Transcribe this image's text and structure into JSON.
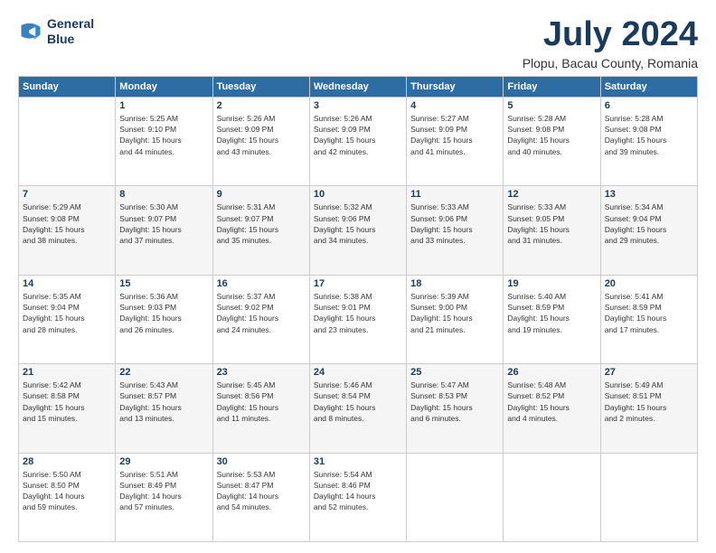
{
  "header": {
    "logo_line1": "General",
    "logo_line2": "Blue",
    "title": "July 2024",
    "subtitle": "Plopu, Bacau County, Romania"
  },
  "weekdays": [
    "Sunday",
    "Monday",
    "Tuesday",
    "Wednesday",
    "Thursday",
    "Friday",
    "Saturday"
  ],
  "weeks": [
    [
      {
        "day": "",
        "info": ""
      },
      {
        "day": "1",
        "info": "Sunrise: 5:25 AM\nSunset: 9:10 PM\nDaylight: 15 hours\nand 44 minutes."
      },
      {
        "day": "2",
        "info": "Sunrise: 5:26 AM\nSunset: 9:09 PM\nDaylight: 15 hours\nand 43 minutes."
      },
      {
        "day": "3",
        "info": "Sunrise: 5:26 AM\nSunset: 9:09 PM\nDaylight: 15 hours\nand 42 minutes."
      },
      {
        "day": "4",
        "info": "Sunrise: 5:27 AM\nSunset: 9:09 PM\nDaylight: 15 hours\nand 41 minutes."
      },
      {
        "day": "5",
        "info": "Sunrise: 5:28 AM\nSunset: 9:08 PM\nDaylight: 15 hours\nand 40 minutes."
      },
      {
        "day": "6",
        "info": "Sunrise: 5:28 AM\nSunset: 9:08 PM\nDaylight: 15 hours\nand 39 minutes."
      }
    ],
    [
      {
        "day": "7",
        "info": "Sunrise: 5:29 AM\nSunset: 9:08 PM\nDaylight: 15 hours\nand 38 minutes."
      },
      {
        "day": "8",
        "info": "Sunrise: 5:30 AM\nSunset: 9:07 PM\nDaylight: 15 hours\nand 37 minutes."
      },
      {
        "day": "9",
        "info": "Sunrise: 5:31 AM\nSunset: 9:07 PM\nDaylight: 15 hours\nand 35 minutes."
      },
      {
        "day": "10",
        "info": "Sunrise: 5:32 AM\nSunset: 9:06 PM\nDaylight: 15 hours\nand 34 minutes."
      },
      {
        "day": "11",
        "info": "Sunrise: 5:33 AM\nSunset: 9:06 PM\nDaylight: 15 hours\nand 33 minutes."
      },
      {
        "day": "12",
        "info": "Sunrise: 5:33 AM\nSunset: 9:05 PM\nDaylight: 15 hours\nand 31 minutes."
      },
      {
        "day": "13",
        "info": "Sunrise: 5:34 AM\nSunset: 9:04 PM\nDaylight: 15 hours\nand 29 minutes."
      }
    ],
    [
      {
        "day": "14",
        "info": "Sunrise: 5:35 AM\nSunset: 9:04 PM\nDaylight: 15 hours\nand 28 minutes."
      },
      {
        "day": "15",
        "info": "Sunrise: 5:36 AM\nSunset: 9:03 PM\nDaylight: 15 hours\nand 26 minutes."
      },
      {
        "day": "16",
        "info": "Sunrise: 5:37 AM\nSunset: 9:02 PM\nDaylight: 15 hours\nand 24 minutes."
      },
      {
        "day": "17",
        "info": "Sunrise: 5:38 AM\nSunset: 9:01 PM\nDaylight: 15 hours\nand 23 minutes."
      },
      {
        "day": "18",
        "info": "Sunrise: 5:39 AM\nSunset: 9:00 PM\nDaylight: 15 hours\nand 21 minutes."
      },
      {
        "day": "19",
        "info": "Sunrise: 5:40 AM\nSunset: 8:59 PM\nDaylight: 15 hours\nand 19 minutes."
      },
      {
        "day": "20",
        "info": "Sunrise: 5:41 AM\nSunset: 8:59 PM\nDaylight: 15 hours\nand 17 minutes."
      }
    ],
    [
      {
        "day": "21",
        "info": "Sunrise: 5:42 AM\nSunset: 8:58 PM\nDaylight: 15 hours\nand 15 minutes."
      },
      {
        "day": "22",
        "info": "Sunrise: 5:43 AM\nSunset: 8:57 PM\nDaylight: 15 hours\nand 13 minutes."
      },
      {
        "day": "23",
        "info": "Sunrise: 5:45 AM\nSunset: 8:56 PM\nDaylight: 15 hours\nand 11 minutes."
      },
      {
        "day": "24",
        "info": "Sunrise: 5:46 AM\nSunset: 8:54 PM\nDaylight: 15 hours\nand 8 minutes."
      },
      {
        "day": "25",
        "info": "Sunrise: 5:47 AM\nSunset: 8:53 PM\nDaylight: 15 hours\nand 6 minutes."
      },
      {
        "day": "26",
        "info": "Sunrise: 5:48 AM\nSunset: 8:52 PM\nDaylight: 15 hours\nand 4 minutes."
      },
      {
        "day": "27",
        "info": "Sunrise: 5:49 AM\nSunset: 8:51 PM\nDaylight: 15 hours\nand 2 minutes."
      }
    ],
    [
      {
        "day": "28",
        "info": "Sunrise: 5:50 AM\nSunset: 8:50 PM\nDaylight: 14 hours\nand 59 minutes."
      },
      {
        "day": "29",
        "info": "Sunrise: 5:51 AM\nSunset: 8:49 PM\nDaylight: 14 hours\nand 57 minutes."
      },
      {
        "day": "30",
        "info": "Sunrise: 5:53 AM\nSunset: 8:47 PM\nDaylight: 14 hours\nand 54 minutes."
      },
      {
        "day": "31",
        "info": "Sunrise: 5:54 AM\nSunset: 8:46 PM\nDaylight: 14 hours\nand 52 minutes."
      },
      {
        "day": "",
        "info": ""
      },
      {
        "day": "",
        "info": ""
      },
      {
        "day": "",
        "info": ""
      }
    ]
  ]
}
